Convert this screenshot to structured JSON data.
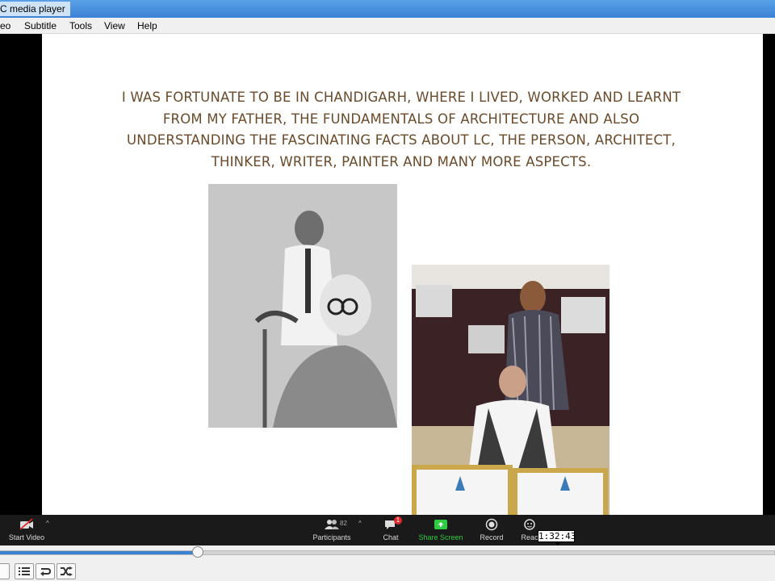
{
  "window": {
    "title": "C media player"
  },
  "menu": {
    "items": [
      "eo",
      "Subtitle",
      "Tools",
      "View",
      "Help"
    ]
  },
  "slide": {
    "text_lines": [
      "I WAS FORTUNATE TO BE IN CHANDIGARH,  WHERE I LIVED, WORKED AND LEARNT",
      "FROM MY FATHER, THE FUNDAMENTALS OF ARCHITECTURE AND ALSO",
      "UNDERSTANDING THE FASCINATING FACTS ABOUT LC, THE PERSON, ARCHITECT,",
      "THINKER, WRITER, PAINTER AND MANY MORE ASPECTS."
    ]
  },
  "zoom_toolbar": {
    "start_video": "Start Video",
    "participants": "Participants",
    "participants_count": "82",
    "chat": "Chat",
    "chat_badge": "1",
    "share_screen": "Share Screen",
    "record": "Record",
    "reactions": "Reac",
    "share_color": "#2ecc40"
  },
  "seek": {
    "time_tooltip": "1:32:43",
    "progress": 0.255,
    "accent": "#3c82d2"
  },
  "controls": {
    "icons": [
      "playlist-icon",
      "loop-icon",
      "shuffle-icon"
    ]
  }
}
